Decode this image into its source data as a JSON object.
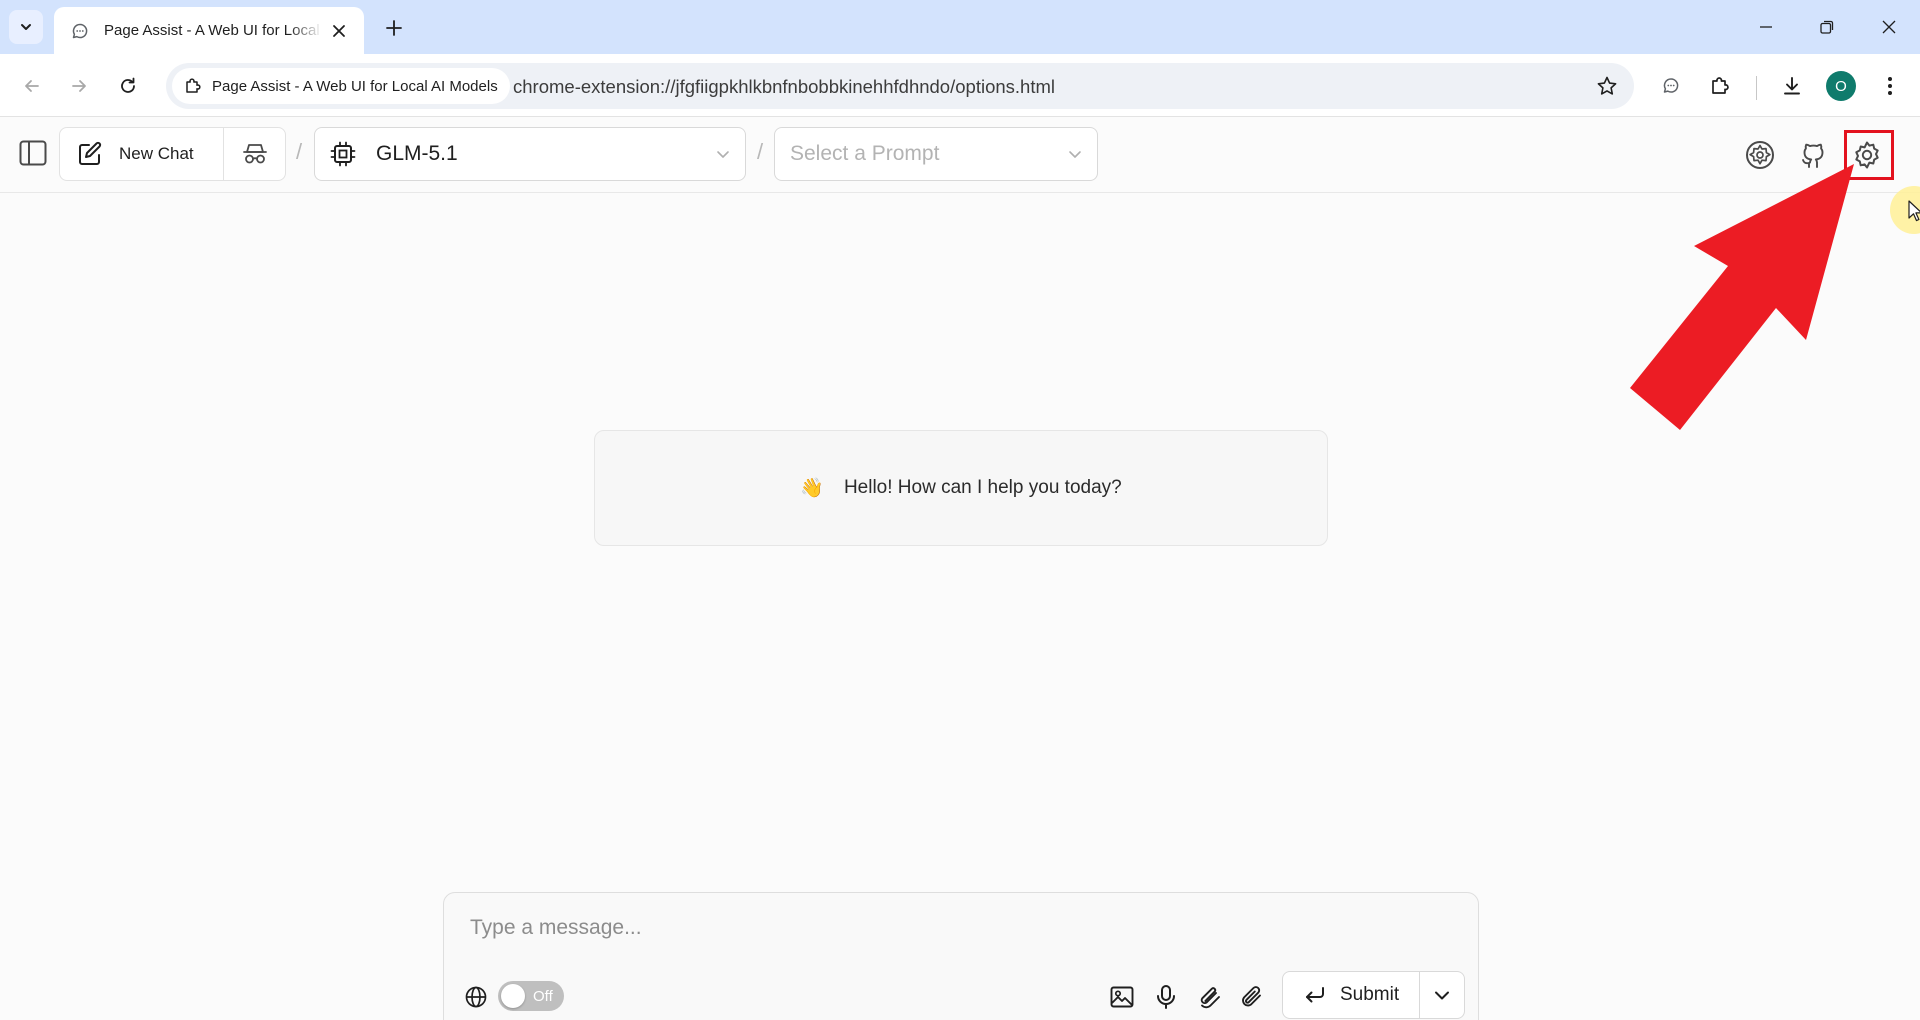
{
  "browser": {
    "tab": {
      "title": "Page Assist - A Web UI for Local AI Models"
    },
    "omnibox": {
      "site_chip": "Page Assist - A Web UI for Local AI Models",
      "url": "chrome-extension://jfgfiigpkhlkbnfnbobbkinehhfdhndo/options.html"
    },
    "profile_initial": "O",
    "colors": {
      "tab_strip": "#d3e3fd",
      "profile": "#0f7b6c"
    }
  },
  "header": {
    "new_chat_label": "New Chat",
    "separator": "/",
    "model": "GLM-5.1",
    "prompt_placeholder": "Select a Prompt",
    "icons": [
      "sidebar-toggle-icon",
      "new-chat-icon",
      "incognito-icon",
      "cpu-icon",
      "chevron-down-icon",
      "ollama-settings-icon",
      "github-icon",
      "settings-gear-icon"
    ]
  },
  "main": {
    "greeting_emoji": "👋",
    "greeting": "Hello! How can I help you today?"
  },
  "composer": {
    "placeholder": "Type a message...",
    "web_search_toggle": "Off",
    "submit_label": "Submit",
    "icons": [
      "globe-icon",
      "image-icon",
      "microphone-icon",
      "attach-document-icon",
      "paperclip-icon",
      "enter-icon",
      "chevron-down-icon"
    ]
  },
  "annotation": {
    "highlight_color": "#e3121e",
    "arrow_color": "#ec1c24",
    "target": "settings-gear-icon"
  }
}
